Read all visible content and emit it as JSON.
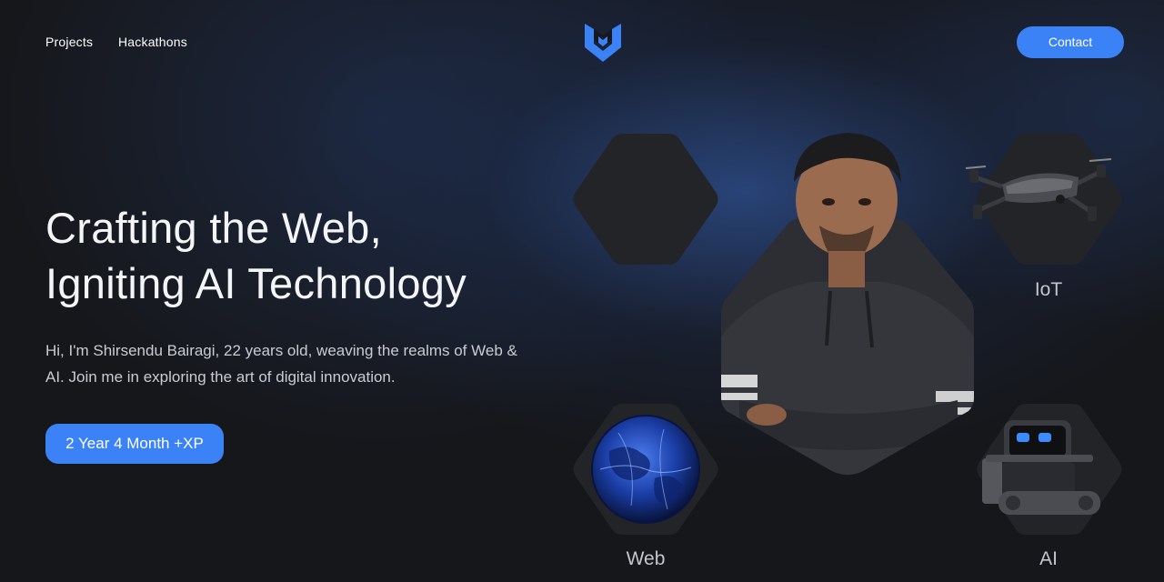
{
  "nav": {
    "projects_label": "Projects",
    "hackathons_label": "Hackathons",
    "contact_label": "Contact"
  },
  "hero": {
    "headline_line1": "Crafting the Web,",
    "headline_line2": "Igniting AI Technology",
    "intro": "Hi, I'm Shirsendu Bairagi, 22 years old, weaving the realms of Web & AI. Join me in exploring the art of digital innovation.",
    "experience_label": "2 Year 4 Month +XP"
  },
  "showcase": {
    "iot_label": "IoT",
    "web_label": "Web",
    "ai_label": "AI"
  },
  "icons": {
    "logo": "brand-logo-icon",
    "iot": "drone-icon",
    "web": "globe-icon",
    "ai": "robot-icon",
    "portrait": "profile-photo"
  },
  "colors": {
    "accent": "#3b82f6",
    "background": "#16171b",
    "hex_fill": "#232428"
  }
}
